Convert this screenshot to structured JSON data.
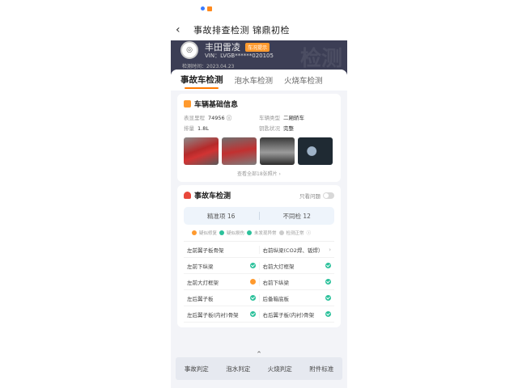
{
  "nav": {
    "title": "事故排查检测 锦鼎初检"
  },
  "hero": {
    "car_name": "丰田雷凌",
    "tag": "车况提示",
    "vin": "VIN：LVGB******020105",
    "date": "检测时间：2023.04.23",
    "watermark": "检测"
  },
  "tabs": [
    "事故车检测",
    "泡水车检测",
    "火烧车检测"
  ],
  "basic": {
    "title": "车辆基础信息",
    "fields": [
      {
        "label": "表显里程",
        "value": "74956 ⓘ"
      },
      {
        "label": "车辆类型",
        "value": "二厢轿车"
      },
      {
        "label": "排量",
        "value": "1.8L"
      },
      {
        "label": "钥匙状况",
        "value": "完整"
      }
    ],
    "more": "查看全部18张照片 ›"
  },
  "detect": {
    "title": "事故车检测",
    "toggle_label": "只看问题",
    "summary_ok": "精准项 16",
    "summary_bad": "不同检 12",
    "legend": [
      "疑似修复",
      "疑似损伤",
      "未发现异常",
      "检测正常",
      "ⓘ"
    ],
    "rows": [
      {
        "left": "左前翼子板骨架",
        "right": "右前纵梁(CO2焊、钣焊）",
        "left_status": "none",
        "right_status": "chevron"
      },
      {
        "left": "左前下纵梁",
        "right": "右前大灯框架",
        "left_status": "ok",
        "right_status": "ok"
      },
      {
        "left": "左前大灯框架",
        "right": "右前下纵梁",
        "left_status": "warn",
        "right_status": "ok"
      },
      {
        "left": "左后翼子板",
        "right": "后备箱底板",
        "left_status": "ok",
        "right_status": "ok"
      },
      {
        "left": "左后翼子板(内衬)骨架",
        "right": "右后翼子板(内衬)骨架",
        "left_status": "ok",
        "right_status": "ok"
      }
    ]
  },
  "bottom_tabs": [
    "事故判定",
    "泡水判定",
    "火烧判定",
    "附件标准"
  ],
  "colors": {
    "accent": "#ff7a00",
    "ok": "#2cc19b",
    "warn": "#ff9a2e",
    "hero_bg": "#3c3e55"
  }
}
